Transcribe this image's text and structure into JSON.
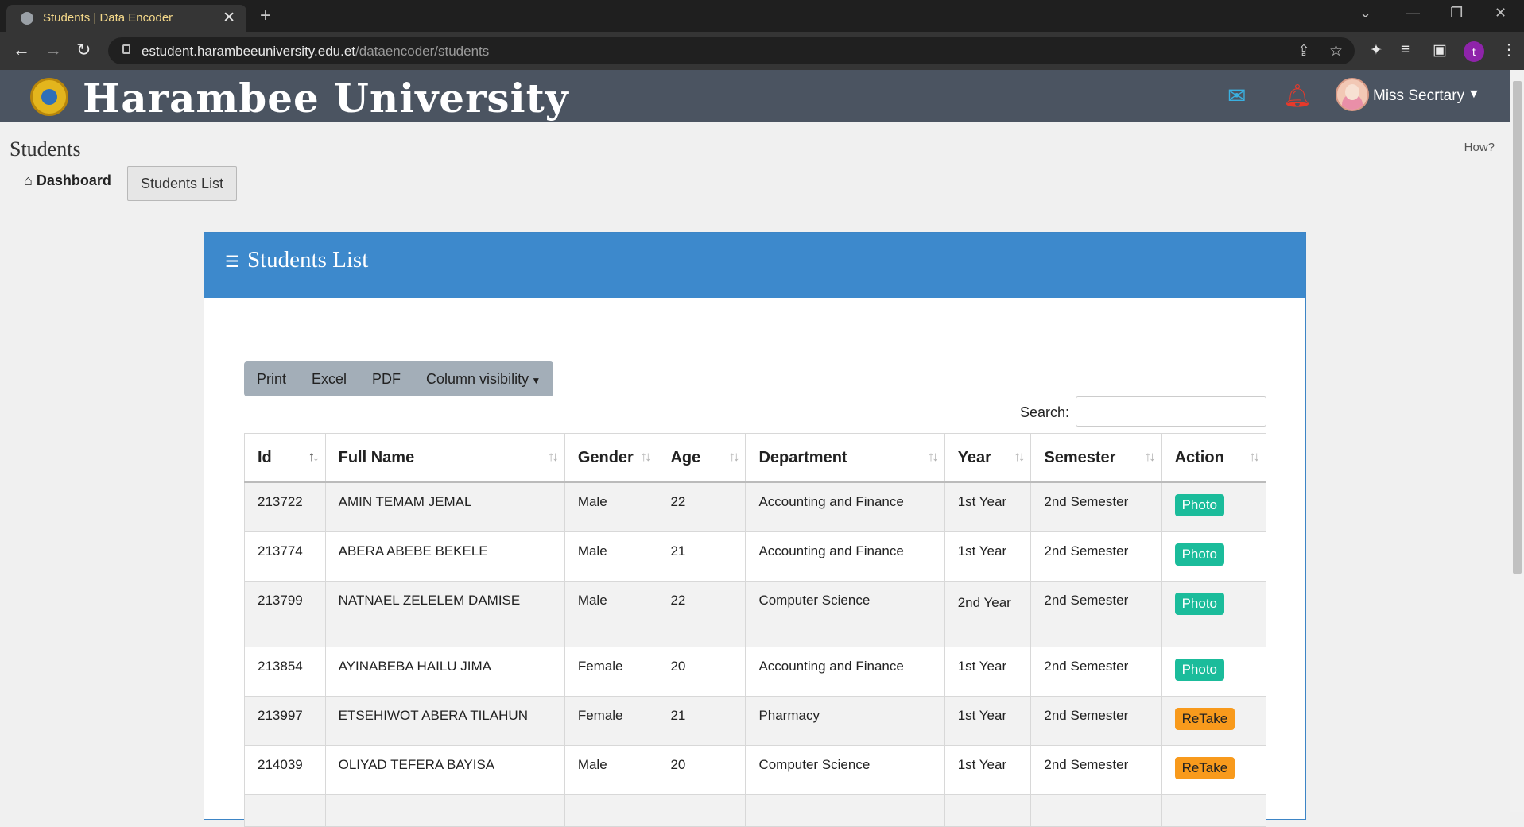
{
  "browser": {
    "tab_title": "Students | Data Encoder",
    "url_host": "estudent.harambeeuniversity.edu.et",
    "url_path": "/dataencoder/students",
    "profile_initial": "t"
  },
  "header": {
    "brand": "Harambee University",
    "user_name": "Miss Secrtary"
  },
  "page": {
    "title": "Students",
    "help_link": "How?",
    "breadcrumb_home": "Dashboard",
    "breadcrumb_current": "Students List"
  },
  "card": {
    "title": "Students List",
    "buttons": [
      "Print",
      "Excel",
      "PDF",
      "Column visibility"
    ],
    "search_label": "Search:",
    "columns": [
      "Id",
      "Full Name",
      "Gender",
      "Age",
      "Department",
      "Year",
      "Semester",
      "Action"
    ],
    "rows": [
      {
        "id": "213722",
        "name": "AMIN TEMAM JEMAL",
        "gender": "Male",
        "age": "22",
        "department": "Accounting and Finance",
        "year": "1st Year",
        "semester": "2nd Semester",
        "action": "Photo",
        "action_type": "green"
      },
      {
        "id": "213774",
        "name": "ABERA ABEBE BEKELE",
        "gender": "Male",
        "age": "21",
        "department": "Accounting and Finance",
        "year": "1st Year",
        "semester": "2nd Semester",
        "action": "Photo",
        "action_type": "green"
      },
      {
        "id": "213799",
        "name": "NATNAEL ZELELEM DAMISE",
        "gender": "Male",
        "age": "22",
        "department": "Computer Science",
        "year": "2nd Year",
        "semester": "2nd Semester",
        "action": "Photo",
        "action_type": "green"
      },
      {
        "id": "213854",
        "name": "AYINABEBA HAILU JIMA",
        "gender": "Female",
        "age": "20",
        "department": "Accounting and Finance",
        "year": "1st Year",
        "semester": "2nd Semester",
        "action": "Photo",
        "action_type": "green"
      },
      {
        "id": "213997",
        "name": "ETSEHIWOT ABERA TILAHUN",
        "gender": "Female",
        "age": "21",
        "department": "Pharmacy",
        "year": "1st Year",
        "semester": "2nd Semester",
        "action": "ReTake",
        "action_type": "orange"
      },
      {
        "id": "214039",
        "name": "OLIYAD TEFERA BAYISA",
        "gender": "Male",
        "age": "20",
        "department": "Computer Science",
        "year": "1st Year",
        "semester": "2nd Semester",
        "action": "ReTake",
        "action_type": "orange"
      }
    ]
  },
  "colors": {
    "header_bg": "#4b5461",
    "card_head": "#3d89cc",
    "badge_photo": "#1bbc9b",
    "badge_retake": "#f89a1c"
  }
}
